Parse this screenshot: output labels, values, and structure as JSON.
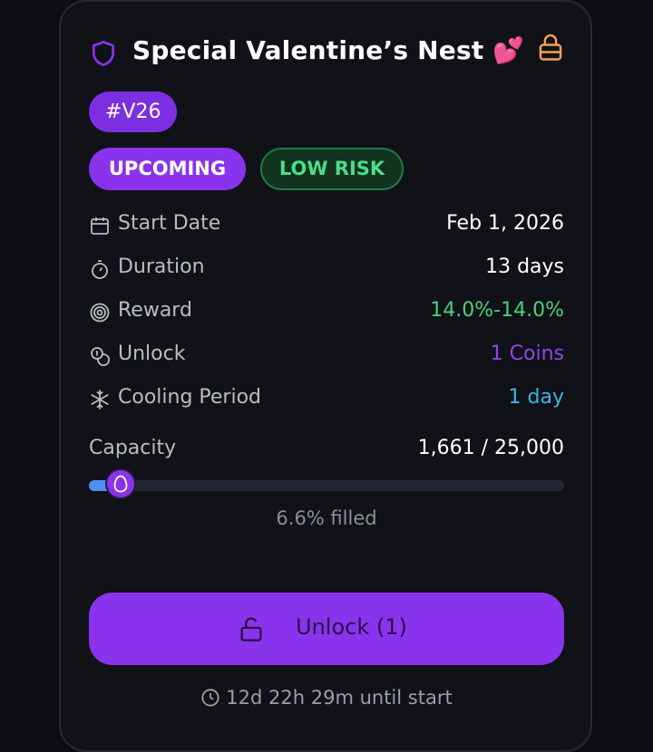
{
  "nest": {
    "title": "Special Valentine’s Nest 💕",
    "code": "#V26",
    "status": "UPCOMING",
    "risk": "LOW RISK"
  },
  "details": {
    "start_date": {
      "label": "Start Date",
      "value": "Feb 1, 2026",
      "icon": "calendar-icon"
    },
    "duration": {
      "label": "Duration",
      "value": "13 days",
      "icon": "stopwatch-icon"
    },
    "reward": {
      "label": "Reward",
      "value": "14.0%-14.0%",
      "icon": "target-icon",
      "color": "#4fce7a"
    },
    "unlock": {
      "label": "Unlock",
      "value": "1 Coins",
      "icon": "coins-icon",
      "color": "#8f46e6"
    },
    "cooling": {
      "label": "Cooling Period",
      "value": "1 day",
      "icon": "snowflake-icon",
      "color": "#39b6e0"
    }
  },
  "capacity": {
    "label": "Capacity",
    "value": "1,661 / 25,000",
    "filled_fraction": 0.066,
    "filled_text": "6.6% filled"
  },
  "action": {
    "unlock_label": "Unlock (1)",
    "icon": "unlock-icon"
  },
  "footer": {
    "countdown": "12d 22h 29m until start",
    "icon": "clock-icon"
  },
  "colors": {
    "accent_purple": "#8a33ec",
    "low_risk_green": "#4fdc86",
    "lock_orange": "#f5a05a"
  }
}
